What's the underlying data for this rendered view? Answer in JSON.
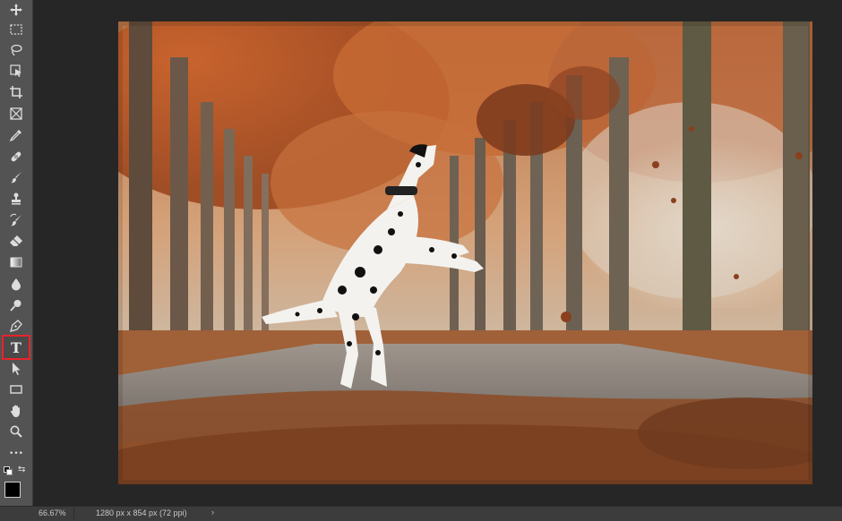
{
  "tools": [
    {
      "name": "move-tool",
      "icon": "move-icon"
    },
    {
      "name": "marquee-tool",
      "icon": "rect-marquee-icon"
    },
    {
      "name": "lasso-tool",
      "icon": "lasso-icon"
    },
    {
      "name": "object-select-tool",
      "icon": "object-select-icon"
    },
    {
      "name": "crop-tool",
      "icon": "crop-icon"
    },
    {
      "name": "frame-tool",
      "icon": "frame-icon"
    },
    {
      "name": "eyedropper-tool",
      "icon": "eyedropper-icon"
    },
    {
      "name": "healing-brush-tool",
      "icon": "bandage-icon"
    },
    {
      "name": "brush-tool",
      "icon": "brush-icon"
    },
    {
      "name": "clone-stamp-tool",
      "icon": "stamp-icon"
    },
    {
      "name": "history-brush-tool",
      "icon": "history-brush-icon"
    },
    {
      "name": "eraser-tool",
      "icon": "eraser-icon"
    },
    {
      "name": "gradient-tool",
      "icon": "gradient-icon"
    },
    {
      "name": "blur-tool",
      "icon": "drop-icon"
    },
    {
      "name": "dodge-tool",
      "icon": "dodge-icon"
    },
    {
      "name": "pen-tool",
      "icon": "pen-icon"
    },
    {
      "name": "type-tool",
      "icon": "type-icon",
      "label": "T",
      "selected": true
    },
    {
      "name": "path-select-tool",
      "icon": "arrow-icon"
    },
    {
      "name": "rectangle-tool",
      "icon": "rectangle-icon"
    },
    {
      "name": "hand-tool",
      "icon": "hand-icon"
    },
    {
      "name": "zoom-tool",
      "icon": "zoom-icon"
    },
    {
      "name": "more-tools",
      "icon": "ellipsis-icon",
      "label": "•••"
    }
  ],
  "colors": {
    "foreground": "#000000",
    "background": "#ffffff",
    "selection_highlight": "#e8232a"
  },
  "status": {
    "zoom": "66.67%",
    "doc_info": "1280 px x 854 px (72 ppi)",
    "arrow": "›"
  }
}
